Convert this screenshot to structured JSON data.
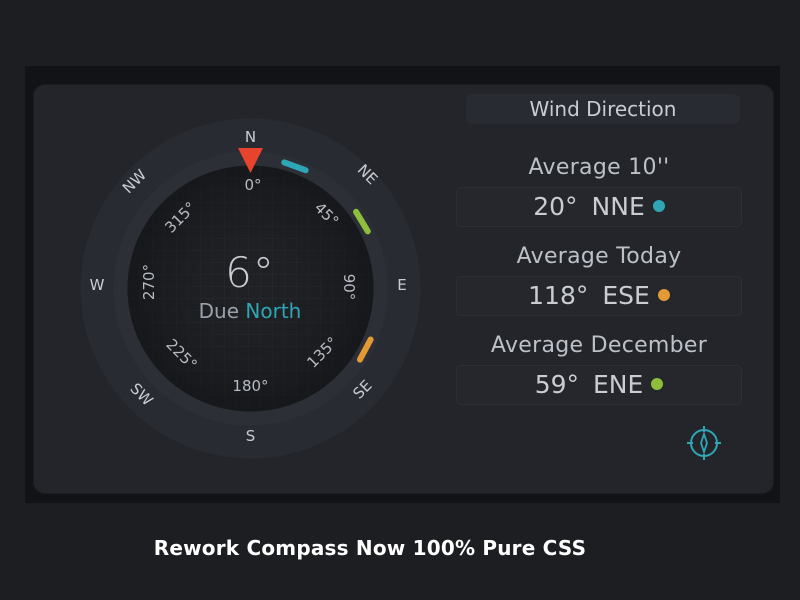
{
  "compass": {
    "cardinals": {
      "n": "N",
      "ne": "NE",
      "e": "E",
      "se": "SE",
      "s": "S",
      "sw": "SW",
      "w": "W",
      "nw": "NW"
    },
    "degree_labels": {
      "d0": "0°",
      "d45": "45°",
      "d90": "90°",
      "d135": "135°",
      "d180": "180°",
      "d225": "225°",
      "d270": "270°",
      "d315": "315°"
    },
    "heading": "6°",
    "heading_value": 6,
    "due_prefix": "Due",
    "due_direction": "North",
    "pointer_color": "#e8432d",
    "accent_color": "#2fa6b5"
  },
  "wind": {
    "title": "Wind Direction",
    "averages": [
      {
        "label": "Average 10''",
        "degrees": "20°",
        "direction": "NNE",
        "color": "#2fa6b5",
        "angle": 20
      },
      {
        "label": "Average Today",
        "degrees": "118°",
        "direction": "ESE",
        "color": "#e39a35",
        "angle": 118
      },
      {
        "label": "Average December",
        "degrees": "59°",
        "direction": "ENE",
        "color": "#8fbf3a",
        "angle": 59
      }
    ]
  },
  "caption": "Rework Compass Now 100% Pure CSS",
  "icons": {
    "compass_button": "compass-icon"
  }
}
